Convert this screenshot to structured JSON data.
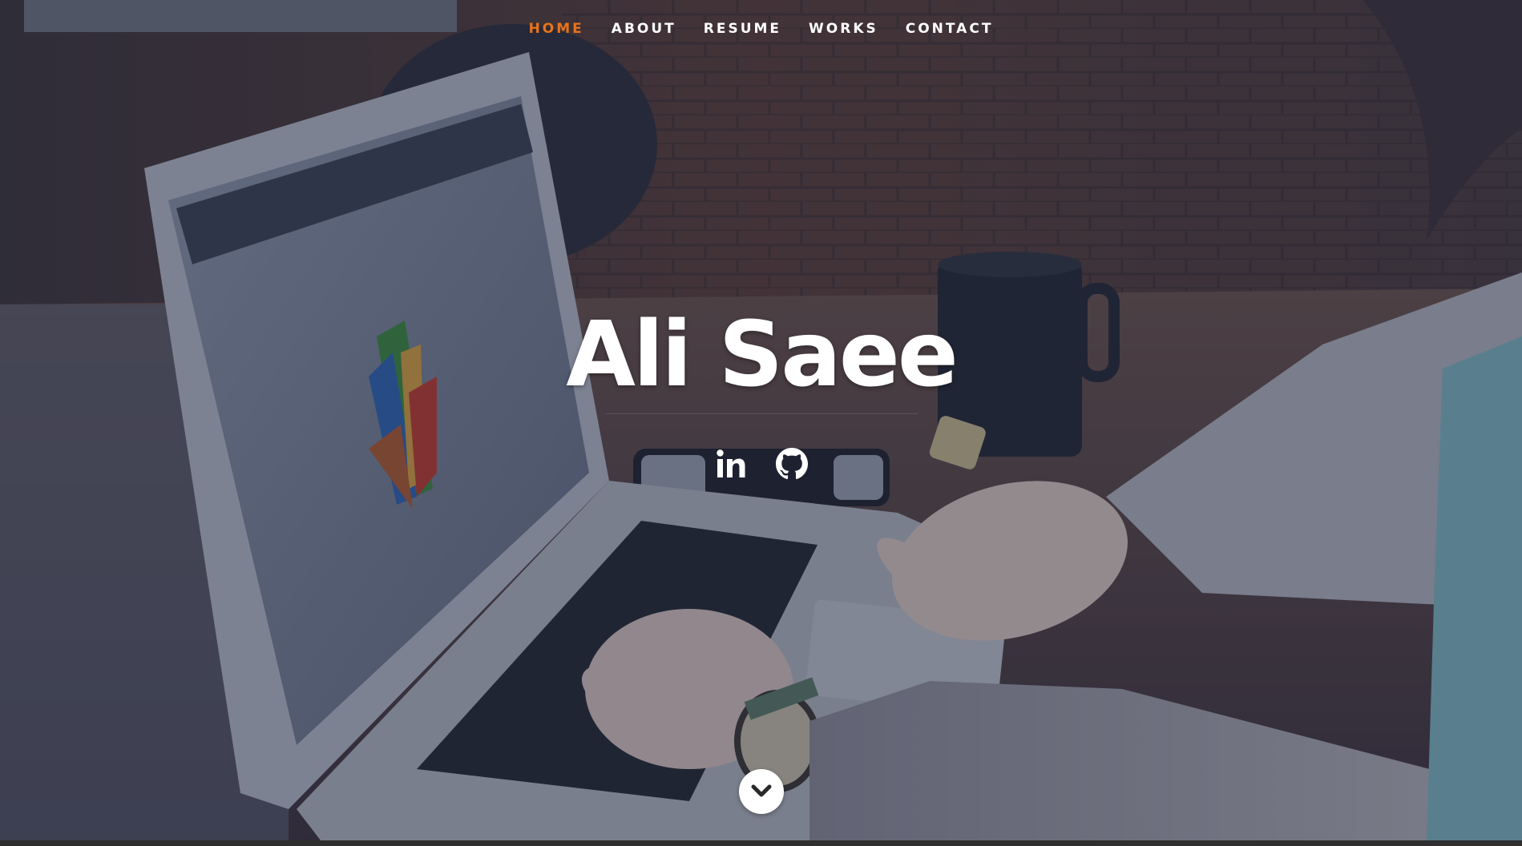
{
  "colors": {
    "accent": "#E8731A",
    "nav_text": "#FFFFFF",
    "overlay": "#1E263E"
  },
  "nav": {
    "items": [
      {
        "label": "HOME",
        "active": true
      },
      {
        "label": "ABOUT",
        "active": false
      },
      {
        "label": "RESUME",
        "active": false
      },
      {
        "label": "WORKS",
        "active": false
      },
      {
        "label": "CONTACT",
        "active": false
      }
    ]
  },
  "banner": {
    "title": "Ali Saee"
  },
  "social": {
    "items": [
      {
        "icon": "linkedin-icon"
      },
      {
        "icon": "github-icon"
      }
    ]
  },
  "scroll": {
    "icon": "chevron-down-icon"
  },
  "background": {
    "description_icon": "background-photo"
  }
}
